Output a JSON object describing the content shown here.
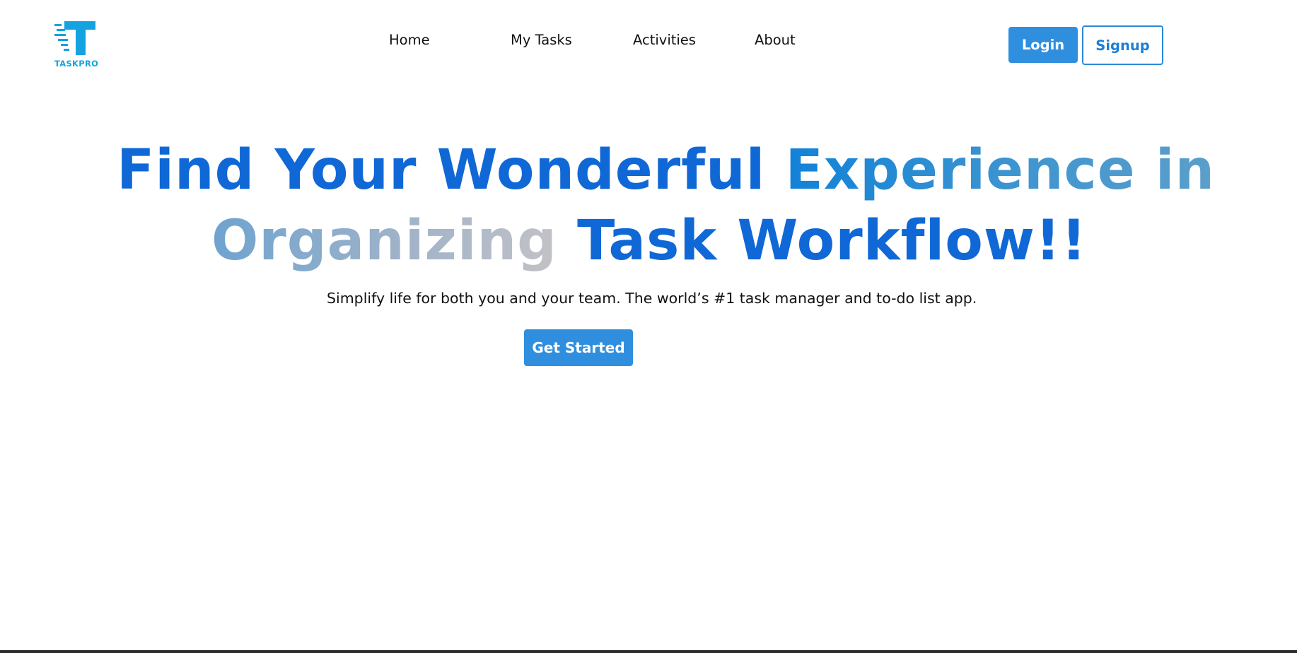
{
  "brand": {
    "name": "TASKPRO",
    "color": "#14a3e0",
    "icon": "taskpro-logo-icon"
  },
  "nav": {
    "items": [
      {
        "label": "Home"
      },
      {
        "label": "My Tasks"
      },
      {
        "label": "Activities"
      },
      {
        "label": "About"
      }
    ]
  },
  "auth": {
    "login_label": "Login",
    "signup_label": "Signup"
  },
  "hero": {
    "line1_part1": "Find Your Wonderful",
    "line1_part2": "Experience in",
    "line2_part1": "Organizing",
    "line2_part2": "Task Workflow!!",
    "subtitle": "Simplify life for both you and your team. The world’s #1 task manager and to-do list app.",
    "cta_label": "Get Started"
  },
  "colors": {
    "primary": "#2f8fde",
    "heading_blue": "#0f68d6",
    "text": "#111111",
    "background": "#ffffff"
  }
}
